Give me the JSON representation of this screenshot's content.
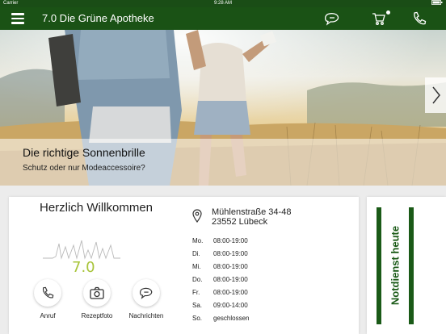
{
  "status_bar": {
    "carrier": "Carrier",
    "time": "9:28 AM"
  },
  "navbar": {
    "title": "7.0 Die Grüne Apotheke",
    "icons": [
      "menu-icon",
      "chat-icon",
      "cart-icon",
      "phone-icon"
    ]
  },
  "hero": {
    "title": "Die richtige Sonnenbrille",
    "subtitle": "Schutz oder nur Modeaccessoire?",
    "next_icon": "chevron-right-icon"
  },
  "welcome": {
    "title": "Herzlich Willkommen",
    "logo_text": "7.0",
    "actions": [
      {
        "label": "Anruf",
        "icon": "phone-icon"
      },
      {
        "label": "Rezeptfoto",
        "icon": "camera-icon"
      },
      {
        "label": "Nachrichten",
        "icon": "chat-icon"
      }
    ]
  },
  "address": {
    "street": "Mühlenstraße 34-48",
    "city": "23552 Lübeck",
    "icon": "location-pin-icon"
  },
  "hours": [
    {
      "day": "Mo.",
      "time": "08:00-19:00"
    },
    {
      "day": "Di.",
      "time": "08:00-19:00"
    },
    {
      "day": "Mi.",
      "time": "08:00-19:00"
    },
    {
      "day": "Do.",
      "time": "08:00-19:00"
    },
    {
      "day": "Fr.",
      "time": "08:00-19:00"
    },
    {
      "day": "Sa.",
      "time": "09:00-14:00"
    },
    {
      "day": "So.",
      "time": "geschlossen"
    }
  ],
  "notdienst": {
    "label": "Notdienst heute"
  },
  "colors": {
    "brand_green": "#1a5215",
    "logo_green": "#a8c43a",
    "background": "#ececec"
  }
}
